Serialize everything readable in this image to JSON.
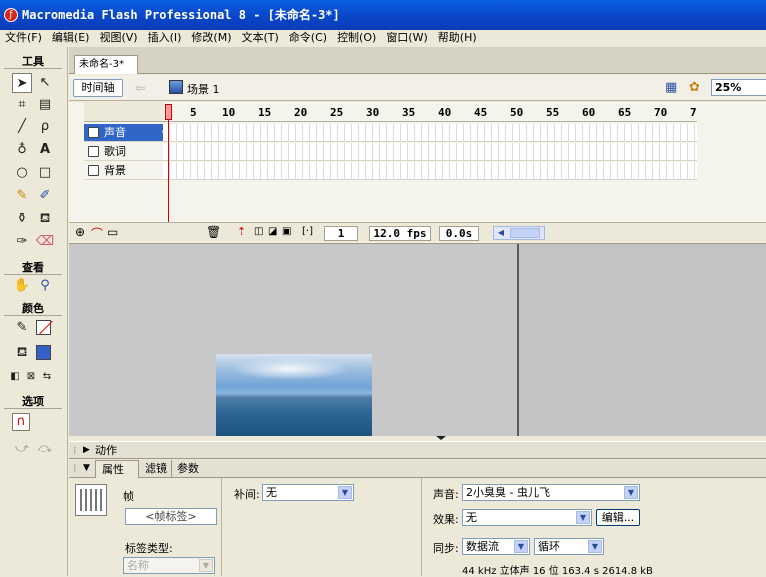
{
  "window": {
    "title": "Macromedia Flash Professional 8 - [未命名-3*]",
    "icon": "flash-app-icon"
  },
  "menu": [
    "文件(F)",
    "编辑(E)",
    "视图(V)",
    "插入(I)",
    "修改(M)",
    "文本(T)",
    "命令(C)",
    "控制(O)",
    "窗口(W)",
    "帮助(H)"
  ],
  "tools": {
    "header": "工具",
    "view_header": "查看",
    "colors_header": "颜色",
    "options_header": "选项"
  },
  "document": {
    "tab": "未命名-3*",
    "timeline_button": "时间轴",
    "scene": "场景 1",
    "zoom": "25%"
  },
  "timeline": {
    "layers": [
      {
        "name": "声音",
        "color": "#ffff66",
        "selected": true
      },
      {
        "name": "歌词",
        "color": "#9933cc",
        "selected": false
      },
      {
        "name": "背景",
        "color": "#33dd33",
        "selected": false
      }
    ],
    "frame_numbers": [
      "1",
      "5",
      "10",
      "15",
      "20",
      "25",
      "30",
      "35",
      "40",
      "45",
      "50",
      "55",
      "60",
      "65",
      "70",
      "7"
    ],
    "current_frame": "1",
    "fps": "12.0 fps",
    "time": "0.0s"
  },
  "panels": {
    "actions_title": "动作",
    "props_tab": "属性",
    "filters_tab": "滤镜",
    "params_tab": "参数"
  },
  "properties": {
    "frame_label": "帧",
    "frame_label_placeholder": "<帧标签>",
    "tween_label": "补间:",
    "tween_value": "无",
    "sound_label": "声音:",
    "sound_value": "2小臭臭 - 虫儿飞",
    "effect_label": "效果:",
    "effect_value": "无",
    "edit_button": "编辑...",
    "label_type_label": "标签类型:",
    "label_type_value": "名称",
    "sync_label": "同步:",
    "sync_value": "数据流",
    "loop_value": "循环",
    "sound_info": "44 kHz 立体声 16 位 163.4 s 2614.8 kB"
  }
}
